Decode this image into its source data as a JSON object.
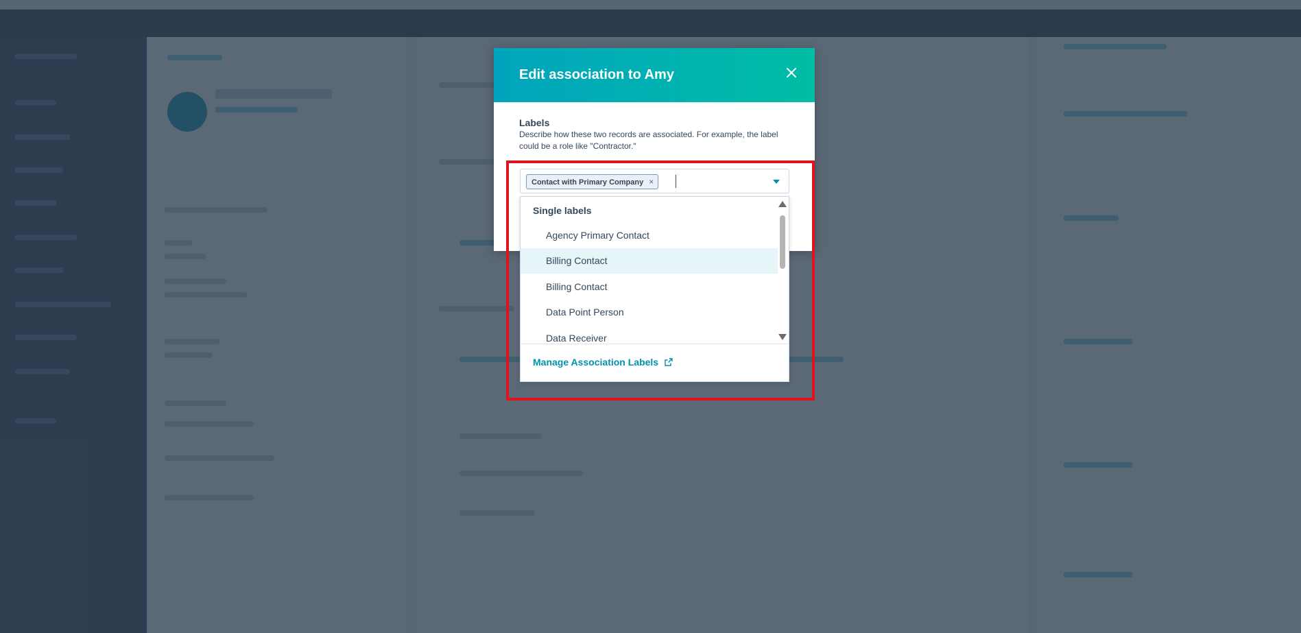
{
  "modal": {
    "title": "Edit association to Amy",
    "labels_heading": "Labels",
    "labels_description": "Describe how these two records are associated. For example, the label could be a role like \"Contractor.\""
  },
  "select": {
    "selected_tag": "Contact with Primary Company",
    "tag_remove": "×"
  },
  "dropdown": {
    "group_heading": "Single labels",
    "options": [
      "Agency Primary Contact",
      "Billing Contact",
      "Billing Contact",
      "Data Point Person",
      "Data Receiver"
    ],
    "hovered_option": "Billing Contact",
    "footer_link": "Manage Association Labels"
  },
  "colors": {
    "header_gradient_start": "#00a4bd",
    "header_gradient_end": "#00bda5",
    "link": "#0091ae",
    "highlight_border": "#e0131a",
    "overlay": "#2d3e50"
  },
  "icons": {
    "close": "close-icon",
    "dropdown": "chevron-down-icon",
    "external_link": "external-link-icon",
    "scroll_up": "scroll-up-arrow-icon",
    "scroll_down": "scroll-down-arrow-icon"
  }
}
